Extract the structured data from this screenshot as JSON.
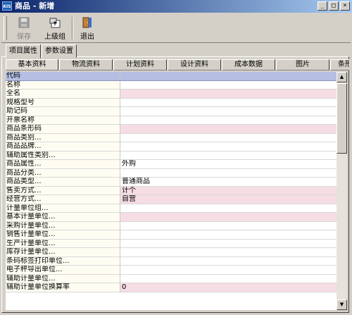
{
  "window": {
    "app_icon_text": "KIS",
    "title": "商品 - 新增",
    "buttons": {
      "minimize": "_",
      "maximize": "□",
      "close": "×"
    }
  },
  "toolbar": {
    "save_label": "保存",
    "parent_label": "上级组",
    "exit_label": "退出"
  },
  "outer_tabs": [
    "项目属性",
    "参数设置"
  ],
  "inner_tabs": [
    "基本资料",
    "物流资料",
    "计划资料",
    "设计资料",
    "成本数据",
    "图片",
    "条形"
  ],
  "grid": {
    "rows": [
      {
        "label": "代码",
        "value": "",
        "header": true
      },
      {
        "label": "名称",
        "value": ""
      },
      {
        "label": "全名",
        "value": "",
        "required": true
      },
      {
        "label": "规格型号",
        "value": ""
      },
      {
        "label": "助记码",
        "value": ""
      },
      {
        "label": "开票名称",
        "value": ""
      },
      {
        "label": "商品条形码",
        "value": "",
        "required": true
      },
      {
        "label": "商品类别...",
        "value": ""
      },
      {
        "label": "商品品牌...",
        "value": ""
      },
      {
        "label": "辅助属性类别...",
        "value": ""
      },
      {
        "label": "商品属性...",
        "value": "外购"
      },
      {
        "label": "商品分类...",
        "value": ""
      },
      {
        "label": "商品类型...",
        "value": "普通商品"
      },
      {
        "label": "售卖方式...",
        "value": "计个",
        "required": true
      },
      {
        "label": "经营方式...",
        "value": "自营",
        "required": true
      },
      {
        "label": "计量单位组...",
        "value": ""
      },
      {
        "label": "基本计量单位...",
        "value": "",
        "required": true
      },
      {
        "label": "采购计量单位...",
        "value": ""
      },
      {
        "label": "销售计量单位...",
        "value": ""
      },
      {
        "label": "生产计量单位...",
        "value": ""
      },
      {
        "label": "库存计量单位...",
        "value": ""
      },
      {
        "label": "条码标签打印单位...",
        "value": ""
      },
      {
        "label": "电子秤导出单位...",
        "value": ""
      },
      {
        "label": "辅助计量单位...",
        "value": ""
      },
      {
        "label": "辅助计量单位换算率",
        "value": "0",
        "required": true
      }
    ]
  },
  "colors": {
    "titlebar_start": "#0a246a",
    "titlebar_end": "#a6caf0",
    "header_row": "#b4bfe3",
    "required_cell": "#f5dde3"
  }
}
